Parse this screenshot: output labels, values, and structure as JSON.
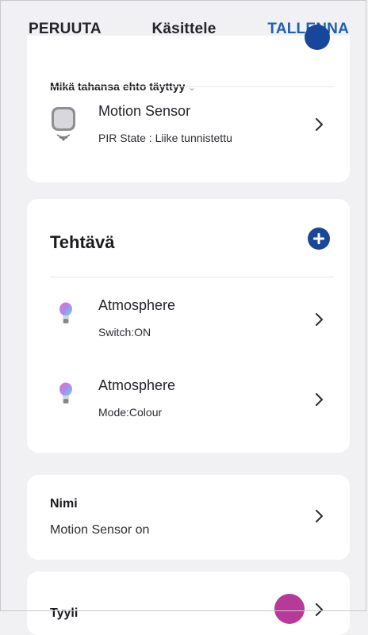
{
  "header": {
    "cancel_label": "PERUUTA",
    "title": "Käsittele",
    "save_label": "TALLENNA"
  },
  "condition": {
    "mode_label": "Mikä tahansa ehto täyttyy",
    "mode_chevron": "⌄",
    "item": {
      "title": "Motion Sensor",
      "subtitle": "PIR State : Liike tunnistettu",
      "icon": "motion-sensor-icon"
    }
  },
  "task": {
    "title": "Tehtävä",
    "add_icon": "plus-circle-icon",
    "items": [
      {
        "title": "Atmosphere",
        "subtitle": "Switch:ON",
        "icon": "bulb-icon"
      },
      {
        "title": "Atmosphere",
        "subtitle": "Mode:Colour",
        "icon": "bulb-icon"
      }
    ]
  },
  "name": {
    "label": "Nimi",
    "value": "Motion Sensor on"
  },
  "style": {
    "label": "Tyyli",
    "swatch_color": "#b7399a"
  },
  "colors": {
    "accent": "#1d5fb5",
    "add_button": "#18469a",
    "background": "#f1f1f3"
  }
}
